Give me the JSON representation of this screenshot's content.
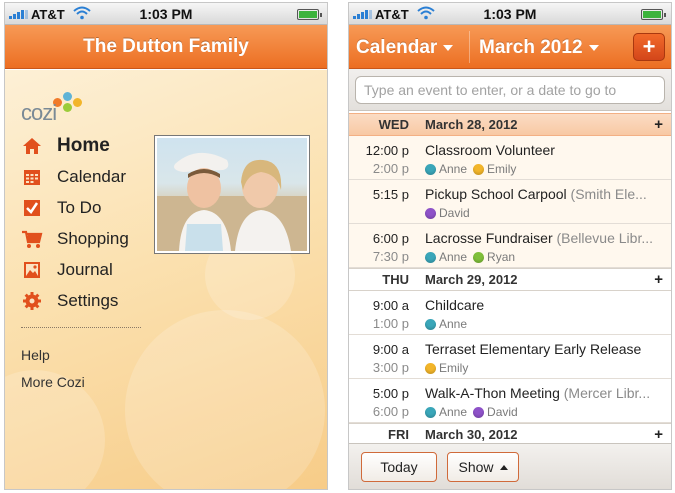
{
  "status": {
    "carrier": "AT&T",
    "time": "1:03 PM"
  },
  "left": {
    "title": "The Dutton Family",
    "logo": "cozi",
    "menu": [
      {
        "label": "Home",
        "icon": "home-icon"
      },
      {
        "label": "Calendar",
        "icon": "calendar-icon"
      },
      {
        "label": "To Do",
        "icon": "checkbox-icon"
      },
      {
        "label": "Shopping",
        "icon": "cart-icon"
      },
      {
        "label": "Journal",
        "icon": "journal-icon"
      },
      {
        "label": "Settings",
        "icon": "gear-icon"
      }
    ],
    "secondary": [
      "Help",
      "More Cozi"
    ]
  },
  "right": {
    "view_dropdown": "Calendar",
    "month_dropdown": "March 2012",
    "add_label": "+",
    "search_placeholder": "Type an event to enter, or a date to go to",
    "days": [
      {
        "dow": "WED",
        "date": "March 28, 2012",
        "today": true,
        "events": [
          {
            "start": "12:00 p",
            "end": "2:00 p",
            "title": "Classroom Volunteer",
            "location": "",
            "people": [
              {
                "name": "Anne",
                "color": "#3aa6b9"
              },
              {
                "name": "Emily",
                "color": "#f2b52a"
              }
            ]
          },
          {
            "start": "5:15 p",
            "end": "",
            "title": "Pickup School Carpool",
            "location": "(Smith Ele...",
            "people": [
              {
                "name": "David",
                "color": "#8e52c8"
              }
            ]
          },
          {
            "start": "6:00 p",
            "end": "7:30 p",
            "title": "Lacrosse Fundraiser",
            "location": "(Bellevue Libr...",
            "people": [
              {
                "name": "Anne",
                "color": "#3aa6b9"
              },
              {
                "name": "Ryan",
                "color": "#7fbf3a"
              }
            ]
          }
        ]
      },
      {
        "dow": "THU",
        "date": "March 29, 2012",
        "today": false,
        "events": [
          {
            "start": "9:00 a",
            "end": "1:00 p",
            "title": "Childcare",
            "location": "",
            "people": [
              {
                "name": "Anne",
                "color": "#3aa6b9"
              }
            ]
          },
          {
            "start": "9:00 a",
            "end": "3:00 p",
            "title": "Terraset Elementary Early Release",
            "location": "",
            "people": [
              {
                "name": "Emily",
                "color": "#f2b52a"
              }
            ]
          },
          {
            "start": "5:00 p",
            "end": "6:00 p",
            "title": "Walk-A-Thon Meeting",
            "location": "(Mercer Libr...",
            "people": [
              {
                "name": "Anne",
                "color": "#3aa6b9"
              },
              {
                "name": "David",
                "color": "#8e52c8"
              }
            ]
          }
        ]
      },
      {
        "dow": "FRI",
        "date": "March 30, 2012",
        "today": false,
        "events": []
      }
    ],
    "day_add_label": "+",
    "bottom": {
      "today_label": "Today",
      "show_label": "Show"
    }
  }
}
